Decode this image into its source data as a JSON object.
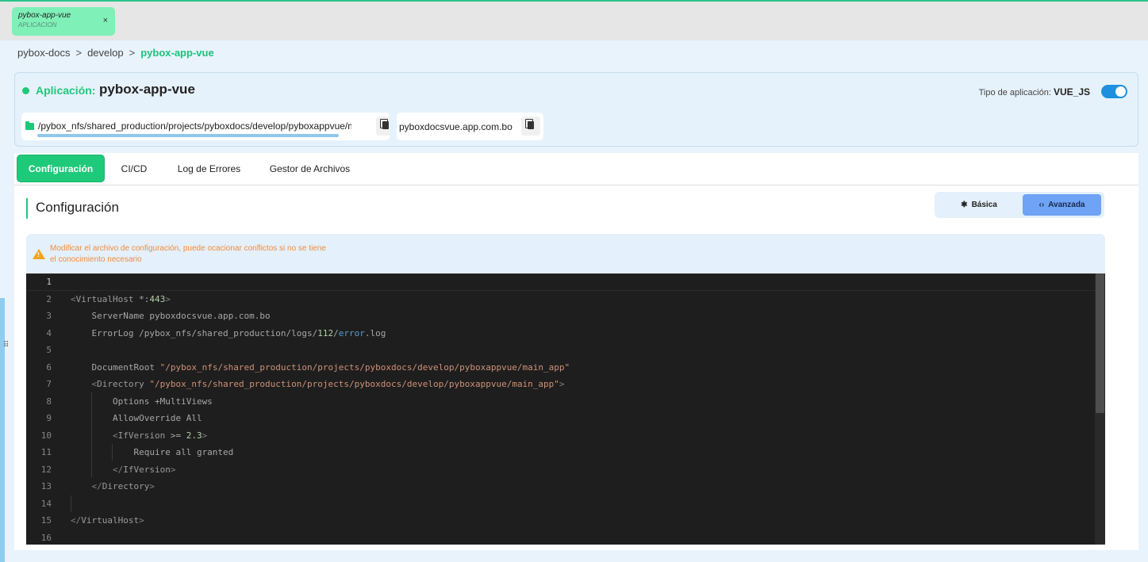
{
  "window": {
    "tab_title": "pybox-app-vue",
    "tab_subtitle": "APLICACION",
    "tab_close": "×"
  },
  "breadcrumb": {
    "items": [
      "pybox-docs",
      "develop"
    ],
    "current": "pybox-app-vue",
    "separator": ">"
  },
  "app": {
    "label": "Aplicación:",
    "name": "pybox-app-vue",
    "type_label": "Tipo de aplicación:",
    "type_value": "VUE_JS",
    "toggle_on": true,
    "path": "/pybox_nfs/shared_production/projects/pyboxdocs/develop/pyboxappvue/main_app",
    "domain": "pyboxdocsvue.app.com.bo"
  },
  "tabs": [
    {
      "label": "Configuración",
      "active": true
    },
    {
      "label": "CI/CD",
      "active": false
    },
    {
      "label": "Log de Errores",
      "active": false
    },
    {
      "label": "Gestor de Archivos",
      "active": false
    }
  ],
  "config": {
    "title": "Configuración",
    "mode_basic": "Básica",
    "mode_advanced": "Avanzada",
    "active_mode": "Avanzada",
    "warning_line1": "Modificar el archivo de configuración, puede ocacionar conflictos si no se tiene",
    "warning_line2": "el conocimiento necesario"
  },
  "editor": {
    "lines": [
      "",
      "<VirtualHost *:443>",
      "    ServerName pyboxdocsvue.app.com.bo",
      "    ErrorLog /pybox_nfs/shared_production/logs/112/error.log",
      "",
      "    DocumentRoot \"/pybox_nfs/shared_production/projects/pyboxdocs/develop/pyboxappvue/main_app\"",
      "    <Directory \"/pybox_nfs/shared_production/projects/pyboxdocs/develop/pyboxappvue/main_app\">",
      "        Options +MultiViews",
      "        AllowOverride All",
      "        <IfVersion >= 2.3>",
      "            Require all granted",
      "        </IfVersion>",
      "    </Directory>",
      "",
      "</VirtualHost>",
      ""
    ],
    "current_line": 1
  },
  "colors": {
    "accent_green": "#1fc97a",
    "toggle_blue": "#1f8fe0",
    "warning_orange": "#ef8d3d",
    "editor_bg": "#1e1e1e"
  }
}
